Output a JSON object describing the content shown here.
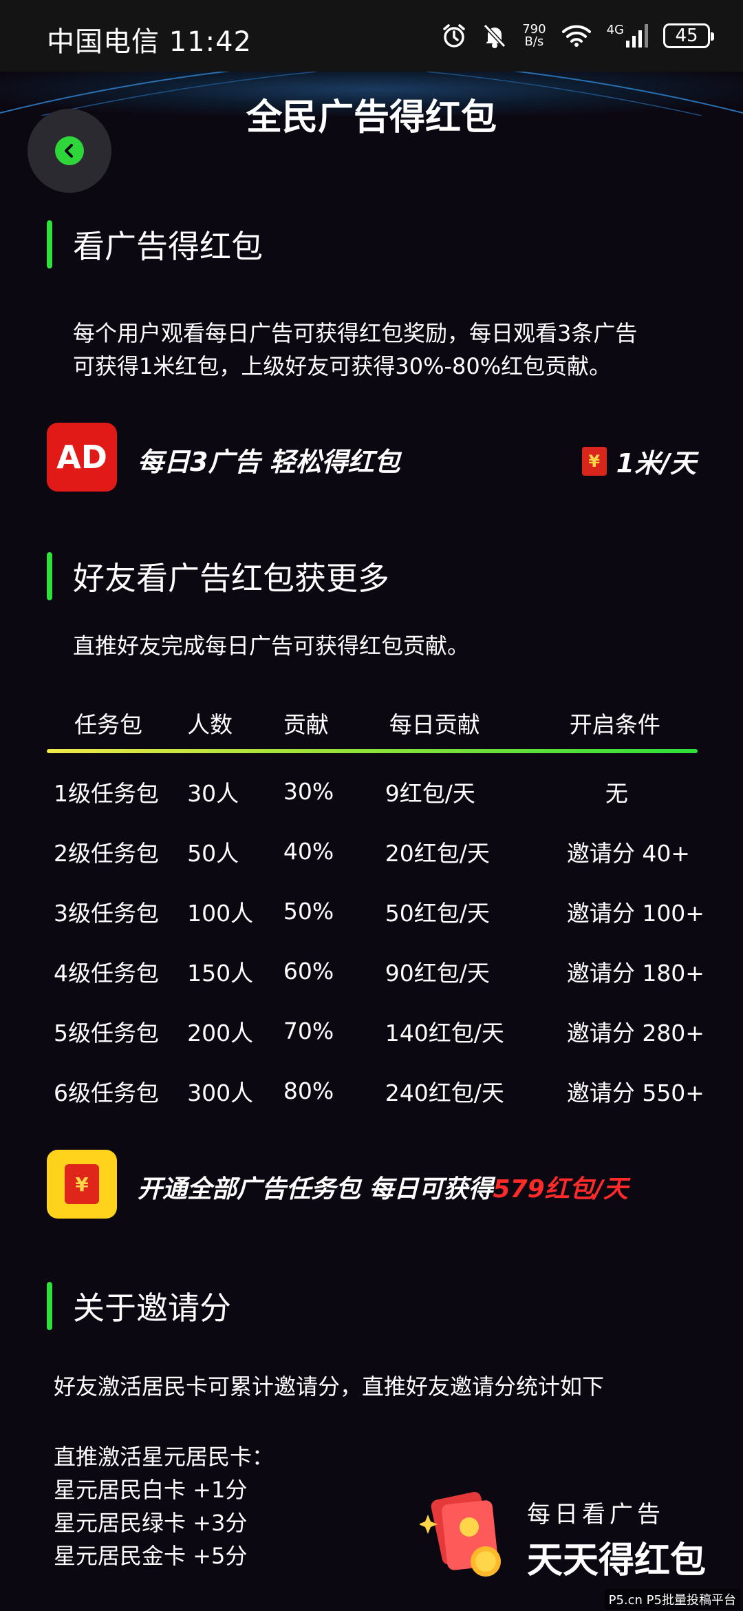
{
  "status_bar": {
    "carrier": "中国电信",
    "time": "11:42",
    "net_speed_value": "790",
    "net_speed_unit": "B/s",
    "network": "4G",
    "battery": "45",
    "icons": [
      "alarm-icon",
      "mute-icon",
      "wifi-icon",
      "signal-icon",
      "battery-icon"
    ]
  },
  "header": {
    "title": "全民广告得红包",
    "back_icon": "chevron-left-icon"
  },
  "section1": {
    "title": "看广告得红包",
    "desc_line1": "每个用户观看每日广告可获得红包奖励，每日观看3条广告",
    "desc_line2": "可获得1米红包，上级好友可获得30%-80%红包贡献。",
    "ad_badge": "AD",
    "ad_text": "每日3广告 轻松得红包",
    "ad_rate": "1米/天"
  },
  "section2": {
    "title": "好友看广告红包获更多",
    "desc": "直推好友完成每日广告可获得红包贡献。",
    "table": {
      "headers": [
        "任务包",
        "人数",
        "贡献",
        "每日贡献",
        "开启条件"
      ],
      "rows": [
        [
          "1级任务包",
          "30人",
          "30%",
          "9红包/天",
          "无"
        ],
        [
          "2级任务包",
          "50人",
          "40%",
          "20红包/天",
          "邀请分 40+"
        ],
        [
          "3级任务包",
          "100人",
          "50%",
          "50红包/天",
          "邀请分 100+"
        ],
        [
          "4级任务包",
          "150人",
          "60%",
          "90红包/天",
          "邀请分 180+"
        ],
        [
          "5级任务包",
          "200人",
          "70%",
          "140红包/天",
          "邀请分 280+"
        ],
        [
          "6级任务包",
          "300人",
          "80%",
          "240红包/天",
          "邀请分 550+"
        ]
      ]
    },
    "unlock_text": "开通全部广告任务包 每日可获得",
    "unlock_highlight": "579红包/天"
  },
  "section3": {
    "title": "关于邀请分",
    "desc": "好友激活居民卡可累计邀请分，直推好友邀请分统计如下",
    "list_title": "直推激活星元居民卡：",
    "items": [
      "星元居民白卡 +1分",
      "星元居民绿卡 +3分",
      "星元居民金卡 +5分"
    ]
  },
  "promo": {
    "line1": "每日看广告",
    "line2": "天天得红包"
  },
  "watermark": "P5.cn P5批量投稿平台",
  "colors": {
    "background": "#0c0812",
    "accent_green": "#2fe03a",
    "ad_red": "#e21a17",
    "highlight_red": "#ff2a2a",
    "badge_yellow": "#ffd21c"
  }
}
